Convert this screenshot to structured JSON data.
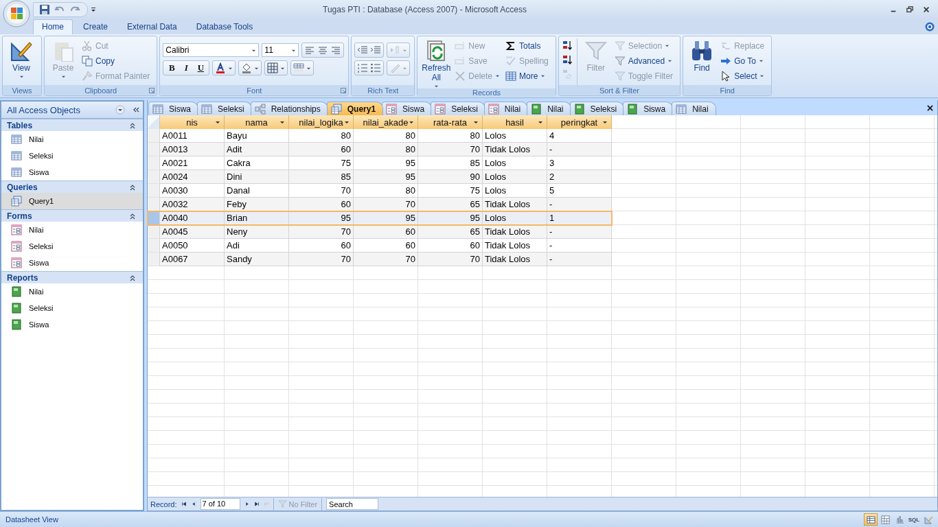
{
  "window": {
    "title": "Tugas PTI : Database (Access 2007) - Microsoft Access"
  },
  "ribbon_tabs": [
    {
      "label": "Home",
      "selected": true
    },
    {
      "label": "Create",
      "selected": false
    },
    {
      "label": "External Data",
      "selected": false
    },
    {
      "label": "Database Tools",
      "selected": false
    }
  ],
  "ribbon_groups": [
    {
      "label": "Views",
      "items": [
        {
          "label": "View",
          "kind": "large",
          "disabled": false,
          "menu": true
        }
      ]
    },
    {
      "label": "Clipboard",
      "items": [
        {
          "label": "Paste",
          "kind": "large",
          "disabled": true,
          "menu": true
        },
        {
          "label": "Cut",
          "kind": "small",
          "disabled": true,
          "menu": false
        },
        {
          "label": "Copy",
          "kind": "small",
          "disabled": false,
          "menu": false
        },
        {
          "label": "Format Painter",
          "kind": "small",
          "disabled": true,
          "menu": false
        }
      ]
    },
    {
      "label": "Font",
      "font": "Calibri",
      "size": "11",
      "styles": [
        "B",
        "I",
        "U"
      ]
    },
    {
      "label": "Rich Text"
    },
    {
      "label": "Records",
      "items": [
        {
          "label": "Refresh All",
          "kind": "large",
          "disabled": false,
          "menu": true
        },
        {
          "label": "New",
          "kind": "small",
          "disabled": true,
          "menu": false
        },
        {
          "label": "Save",
          "kind": "small",
          "disabled": true,
          "menu": false
        },
        {
          "label": "Delete",
          "kind": "small",
          "disabled": true,
          "menu": true
        },
        {
          "label": "Totals",
          "kind": "small",
          "disabled": false,
          "menu": false
        },
        {
          "label": "Spelling",
          "kind": "small",
          "disabled": true,
          "menu": false
        },
        {
          "label": "More",
          "kind": "small",
          "disabled": false,
          "menu": true
        }
      ]
    },
    {
      "label": "Sort & Filter",
      "items": [
        {
          "label": "Filter",
          "kind": "large",
          "disabled": true,
          "menu": false
        },
        {
          "label": "Selection",
          "kind": "small",
          "disabled": true,
          "menu": true
        },
        {
          "label": "Advanced",
          "kind": "small",
          "disabled": false,
          "menu": true
        },
        {
          "label": "Toggle Filter",
          "kind": "small",
          "disabled": true,
          "menu": false
        }
      ]
    },
    {
      "label": "Find",
      "items": [
        {
          "label": "Find",
          "kind": "large",
          "disabled": false,
          "menu": false
        },
        {
          "label": "Replace",
          "kind": "small",
          "disabled": true,
          "menu": false
        },
        {
          "label": "Go To",
          "kind": "small",
          "disabled": false,
          "menu": true
        },
        {
          "label": "Select",
          "kind": "small",
          "disabled": false,
          "menu": true
        }
      ]
    }
  ],
  "nav_pane": {
    "title": "All Access Objects",
    "sections": [
      {
        "title": "Tables",
        "items": [
          {
            "label": "Nilai",
            "kind": "table",
            "selected": false
          },
          {
            "label": "Seleksi",
            "kind": "table",
            "selected": false
          },
          {
            "label": "Siswa",
            "kind": "table",
            "selected": false
          }
        ]
      },
      {
        "title": "Queries",
        "items": [
          {
            "label": "Query1",
            "kind": "query",
            "selected": true
          }
        ]
      },
      {
        "title": "Forms",
        "items": [
          {
            "label": "Nilai",
            "kind": "form",
            "selected": false
          },
          {
            "label": "Seleksi",
            "kind": "form",
            "selected": false
          },
          {
            "label": "Siswa",
            "kind": "form",
            "selected": false
          }
        ]
      },
      {
        "title": "Reports",
        "items": [
          {
            "label": "Nilai",
            "kind": "report",
            "selected": false
          },
          {
            "label": "Seleksi",
            "kind": "report",
            "selected": false
          },
          {
            "label": "Siswa",
            "kind": "report",
            "selected": false
          }
        ]
      }
    ]
  },
  "document_tabs": [
    {
      "label": "Siswa",
      "kind": "table",
      "selected": false
    },
    {
      "label": "Seleksi",
      "kind": "table",
      "selected": false
    },
    {
      "label": "Relationships",
      "kind": "relationships",
      "selected": false
    },
    {
      "label": "Query1",
      "kind": "query",
      "selected": true
    },
    {
      "label": "Siswa",
      "kind": "form",
      "selected": false
    },
    {
      "label": "Seleksi",
      "kind": "form",
      "selected": false
    },
    {
      "label": "Nilai",
      "kind": "form",
      "selected": false
    },
    {
      "label": "Nilai",
      "kind": "report",
      "selected": false
    },
    {
      "label": "Seleksi",
      "kind": "report",
      "selected": false
    },
    {
      "label": "Siswa",
      "kind": "report",
      "selected": false
    },
    {
      "label": "Nilai",
      "kind": "table",
      "selected": false
    }
  ],
  "datasheet": {
    "columns": [
      {
        "label": "nis",
        "kind": "text"
      },
      {
        "label": "nama",
        "kind": "text"
      },
      {
        "label": "nilai_logika",
        "kind": "number"
      },
      {
        "label": "nilai_akade",
        "kind": "number"
      },
      {
        "label": "rata-rata",
        "kind": "number"
      },
      {
        "label": "hasil",
        "kind": "text"
      },
      {
        "label": "peringkat",
        "kind": "text"
      }
    ],
    "rows": [
      {
        "cells": [
          "A0011",
          "Bayu",
          "80",
          "80",
          "80",
          "Lolos",
          "4"
        ],
        "selected": false
      },
      {
        "cells": [
          "A0013",
          "Adit",
          "60",
          "80",
          "70",
          "Tidak Lolos",
          "-"
        ],
        "selected": false
      },
      {
        "cells": [
          "A0021",
          "Cakra",
          "75",
          "95",
          "85",
          "Lolos",
          "3"
        ],
        "selected": false
      },
      {
        "cells": [
          "A0024",
          "Dini",
          "85",
          "95",
          "90",
          "Lolos",
          "2"
        ],
        "selected": false
      },
      {
        "cells": [
          "A0030",
          "Danal",
          "70",
          "80",
          "75",
          "Lolos",
          "5"
        ],
        "selected": false
      },
      {
        "cells": [
          "A0032",
          "Feby",
          "60",
          "70",
          "65",
          "Tidak Lolos",
          "-"
        ],
        "selected": false
      },
      {
        "cells": [
          "A0040",
          "Brian",
          "95",
          "95",
          "95",
          "Lolos",
          "1"
        ],
        "selected": true
      },
      {
        "cells": [
          "A0045",
          "Neny",
          "70",
          "60",
          "65",
          "Tidak Lolos",
          "-"
        ],
        "selected": false
      },
      {
        "cells": [
          "A0050",
          "Adi",
          "60",
          "60",
          "60",
          "Tidak Lolos",
          "-"
        ],
        "selected": false
      },
      {
        "cells": [
          "A0067",
          "Sandy",
          "70",
          "70",
          "70",
          "Tidak Lolos",
          "-"
        ],
        "selected": false
      }
    ]
  },
  "record_nav": {
    "label": "Record:",
    "position": "7 of 10",
    "filter": "No Filter",
    "filter_disabled": true,
    "search_placeholder": "Search"
  },
  "status_bar": {
    "text": "Datasheet View",
    "views": [
      {
        "kind": "datasheet",
        "selected": true
      },
      {
        "kind": "pivot-table",
        "selected": false
      },
      {
        "kind": "pivot-chart",
        "selected": false
      },
      {
        "kind": "sql",
        "label": "SQL",
        "selected": false
      },
      {
        "kind": "design",
        "selected": false
      }
    ]
  }
}
